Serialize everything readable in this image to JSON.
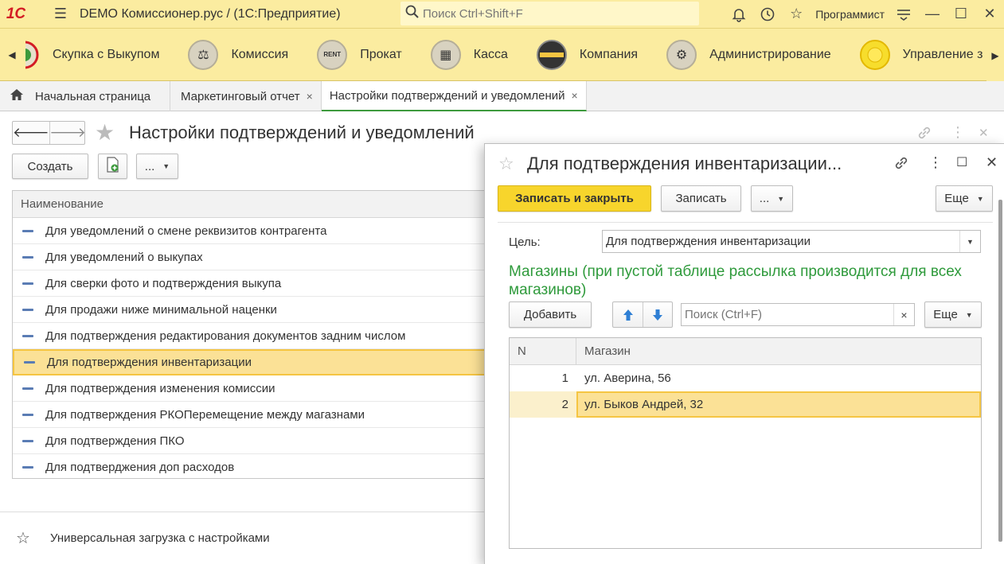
{
  "titlebar": {
    "logo": "1С",
    "app_title": "DEMO Комиссионер.рус /   (1С:Предприятие)",
    "search_placeholder": "Поиск Ctrl+Shift+F",
    "user": "Программист"
  },
  "sections": [
    {
      "label": "Скупка с Выкупом",
      "icon": "buyback-icon"
    },
    {
      "label": "Комиссия",
      "icon": "scales-icon"
    },
    {
      "label": "Прокат",
      "icon": "rent-icon"
    },
    {
      "label": "Касса",
      "icon": "cash-register-icon"
    },
    {
      "label": "Компания",
      "icon": "company-icon"
    },
    {
      "label": "Администрирование",
      "icon": "gears-icon"
    },
    {
      "label": "Управление з",
      "icon": "sun-icon"
    }
  ],
  "tabs": [
    {
      "label": "Начальная страница"
    },
    {
      "label": "Маркетинговый отчет",
      "close": "×"
    },
    {
      "label": "Настройки подтверждений и уведомлений",
      "close": "×"
    }
  ],
  "main": {
    "title": "Настройки подтверждений и уведомлений",
    "create_label": "Создать",
    "more_label": "...",
    "column_header": "Наименование",
    "rows": [
      "Для уведомлений о смене реквизитов контрагента",
      "Для уведомлений о выкупах",
      "Для сверки фото и подтверждения выкупа",
      "Для продажи ниже минимальной наценки",
      "Для подтверждения редактирования документов задним числом",
      "Для подтверждения инвентаризации",
      "Для подтверждения изменения комиссии",
      "Для подтверждения РКОПеремещение между магазнами",
      "Для подтверждения ПКО",
      "Для подтверджения доп расходов"
    ],
    "selected_index": 5
  },
  "bottom": {
    "label": "Универсальная загрузка с настройками"
  },
  "dialog": {
    "title": "Для подтверждения инвентаризации...",
    "save_close_label": "Записать и закрыть",
    "save_label": "Записать",
    "more_label": "...",
    "eshe_label": "Еще",
    "field_label": "Цель:",
    "field_value": "Для подтверждения инвентаризации",
    "group_title": "Магазины (при пустой таблице рассылка производится для всех магазинов)",
    "add_label": "Добавить",
    "search_placeholder": "Поиск (Ctrl+F)",
    "clear": "×",
    "table": {
      "headers": {
        "n": "N",
        "shop": "Магазин"
      },
      "rows": [
        {
          "n": "1",
          "shop": "ул. Аверина, 56"
        },
        {
          "n": "2",
          "shop": "ул. Быков Андрей, 32"
        }
      ],
      "selected_index": 1
    }
  },
  "colors": {
    "accent_yellow": "#fbeca0",
    "primary_button": "#f7d52c",
    "selection": "#fbe196",
    "group_title": "#2e9a3b",
    "active_tab_underline": "#3d9a3d"
  }
}
